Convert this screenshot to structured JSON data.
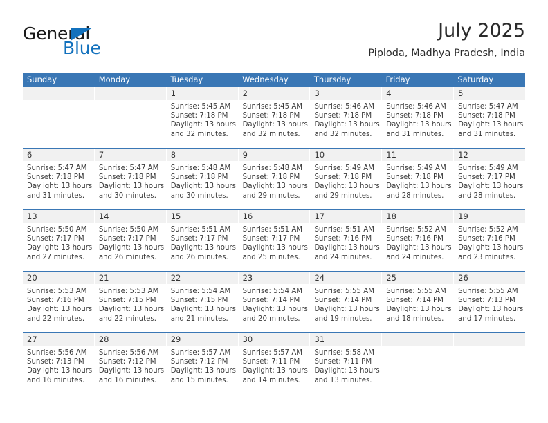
{
  "brand": {
    "name_top": "General",
    "name_bottom": "Blue",
    "triangle_icon": "blue-triangle-logo-mark",
    "color_blue": "#1271bd",
    "color_dark": "#1b1b1b"
  },
  "header": {
    "title": "July 2025",
    "subtitle": "Piploda, Madhya Pradesh, India"
  },
  "theme": {
    "header_blue": "#3a77b5",
    "day_strip_gray": "#f1f1f1",
    "text_dark": "#3a3a3a"
  },
  "weekdays": [
    "Sunday",
    "Monday",
    "Tuesday",
    "Wednesday",
    "Thursday",
    "Friday",
    "Saturday"
  ],
  "weeks": [
    [
      {
        "day": "",
        "lines": []
      },
      {
        "day": "",
        "lines": []
      },
      {
        "day": "1",
        "lines": [
          "Sunrise: 5:45 AM",
          "Sunset: 7:18 PM",
          "Daylight: 13 hours",
          "and 32 minutes."
        ]
      },
      {
        "day": "2",
        "lines": [
          "Sunrise: 5:45 AM",
          "Sunset: 7:18 PM",
          "Daylight: 13 hours",
          "and 32 minutes."
        ]
      },
      {
        "day": "3",
        "lines": [
          "Sunrise: 5:46 AM",
          "Sunset: 7:18 PM",
          "Daylight: 13 hours",
          "and 32 minutes."
        ]
      },
      {
        "day": "4",
        "lines": [
          "Sunrise: 5:46 AM",
          "Sunset: 7:18 PM",
          "Daylight: 13 hours",
          "and 31 minutes."
        ]
      },
      {
        "day": "5",
        "lines": [
          "Sunrise: 5:47 AM",
          "Sunset: 7:18 PM",
          "Daylight: 13 hours",
          "and 31 minutes."
        ]
      }
    ],
    [
      {
        "day": "6",
        "lines": [
          "Sunrise: 5:47 AM",
          "Sunset: 7:18 PM",
          "Daylight: 13 hours",
          "and 31 minutes."
        ]
      },
      {
        "day": "7",
        "lines": [
          "Sunrise: 5:47 AM",
          "Sunset: 7:18 PM",
          "Daylight: 13 hours",
          "and 30 minutes."
        ]
      },
      {
        "day": "8",
        "lines": [
          "Sunrise: 5:48 AM",
          "Sunset: 7:18 PM",
          "Daylight: 13 hours",
          "and 30 minutes."
        ]
      },
      {
        "day": "9",
        "lines": [
          "Sunrise: 5:48 AM",
          "Sunset: 7:18 PM",
          "Daylight: 13 hours",
          "and 29 minutes."
        ]
      },
      {
        "day": "10",
        "lines": [
          "Sunrise: 5:49 AM",
          "Sunset: 7:18 PM",
          "Daylight: 13 hours",
          "and 29 minutes."
        ]
      },
      {
        "day": "11",
        "lines": [
          "Sunrise: 5:49 AM",
          "Sunset: 7:18 PM",
          "Daylight: 13 hours",
          "and 28 minutes."
        ]
      },
      {
        "day": "12",
        "lines": [
          "Sunrise: 5:49 AM",
          "Sunset: 7:17 PM",
          "Daylight: 13 hours",
          "and 28 minutes."
        ]
      }
    ],
    [
      {
        "day": "13",
        "lines": [
          "Sunrise: 5:50 AM",
          "Sunset: 7:17 PM",
          "Daylight: 13 hours",
          "and 27 minutes."
        ]
      },
      {
        "day": "14",
        "lines": [
          "Sunrise: 5:50 AM",
          "Sunset: 7:17 PM",
          "Daylight: 13 hours",
          "and 26 minutes."
        ]
      },
      {
        "day": "15",
        "lines": [
          "Sunrise: 5:51 AM",
          "Sunset: 7:17 PM",
          "Daylight: 13 hours",
          "and 26 minutes."
        ]
      },
      {
        "day": "16",
        "lines": [
          "Sunrise: 5:51 AM",
          "Sunset: 7:17 PM",
          "Daylight: 13 hours",
          "and 25 minutes."
        ]
      },
      {
        "day": "17",
        "lines": [
          "Sunrise: 5:51 AM",
          "Sunset: 7:16 PM",
          "Daylight: 13 hours",
          "and 24 minutes."
        ]
      },
      {
        "day": "18",
        "lines": [
          "Sunrise: 5:52 AM",
          "Sunset: 7:16 PM",
          "Daylight: 13 hours",
          "and 24 minutes."
        ]
      },
      {
        "day": "19",
        "lines": [
          "Sunrise: 5:52 AM",
          "Sunset: 7:16 PM",
          "Daylight: 13 hours",
          "and 23 minutes."
        ]
      }
    ],
    [
      {
        "day": "20",
        "lines": [
          "Sunrise: 5:53 AM",
          "Sunset: 7:16 PM",
          "Daylight: 13 hours",
          "and 22 minutes."
        ]
      },
      {
        "day": "21",
        "lines": [
          "Sunrise: 5:53 AM",
          "Sunset: 7:15 PM",
          "Daylight: 13 hours",
          "and 22 minutes."
        ]
      },
      {
        "day": "22",
        "lines": [
          "Sunrise: 5:54 AM",
          "Sunset: 7:15 PM",
          "Daylight: 13 hours",
          "and 21 minutes."
        ]
      },
      {
        "day": "23",
        "lines": [
          "Sunrise: 5:54 AM",
          "Sunset: 7:14 PM",
          "Daylight: 13 hours",
          "and 20 minutes."
        ]
      },
      {
        "day": "24",
        "lines": [
          "Sunrise: 5:55 AM",
          "Sunset: 7:14 PM",
          "Daylight: 13 hours",
          "and 19 minutes."
        ]
      },
      {
        "day": "25",
        "lines": [
          "Sunrise: 5:55 AM",
          "Sunset: 7:14 PM",
          "Daylight: 13 hours",
          "and 18 minutes."
        ]
      },
      {
        "day": "26",
        "lines": [
          "Sunrise: 5:55 AM",
          "Sunset: 7:13 PM",
          "Daylight: 13 hours",
          "and 17 minutes."
        ]
      }
    ],
    [
      {
        "day": "27",
        "lines": [
          "Sunrise: 5:56 AM",
          "Sunset: 7:13 PM",
          "Daylight: 13 hours",
          "and 16 minutes."
        ]
      },
      {
        "day": "28",
        "lines": [
          "Sunrise: 5:56 AM",
          "Sunset: 7:12 PM",
          "Daylight: 13 hours",
          "and 16 minutes."
        ]
      },
      {
        "day": "29",
        "lines": [
          "Sunrise: 5:57 AM",
          "Sunset: 7:12 PM",
          "Daylight: 13 hours",
          "and 15 minutes."
        ]
      },
      {
        "day": "30",
        "lines": [
          "Sunrise: 5:57 AM",
          "Sunset: 7:11 PM",
          "Daylight: 13 hours",
          "and 14 minutes."
        ]
      },
      {
        "day": "31",
        "lines": [
          "Sunrise: 5:58 AM",
          "Sunset: 7:11 PM",
          "Daylight: 13 hours",
          "and 13 minutes."
        ]
      },
      {
        "day": "",
        "lines": []
      },
      {
        "day": "",
        "lines": []
      }
    ]
  ]
}
